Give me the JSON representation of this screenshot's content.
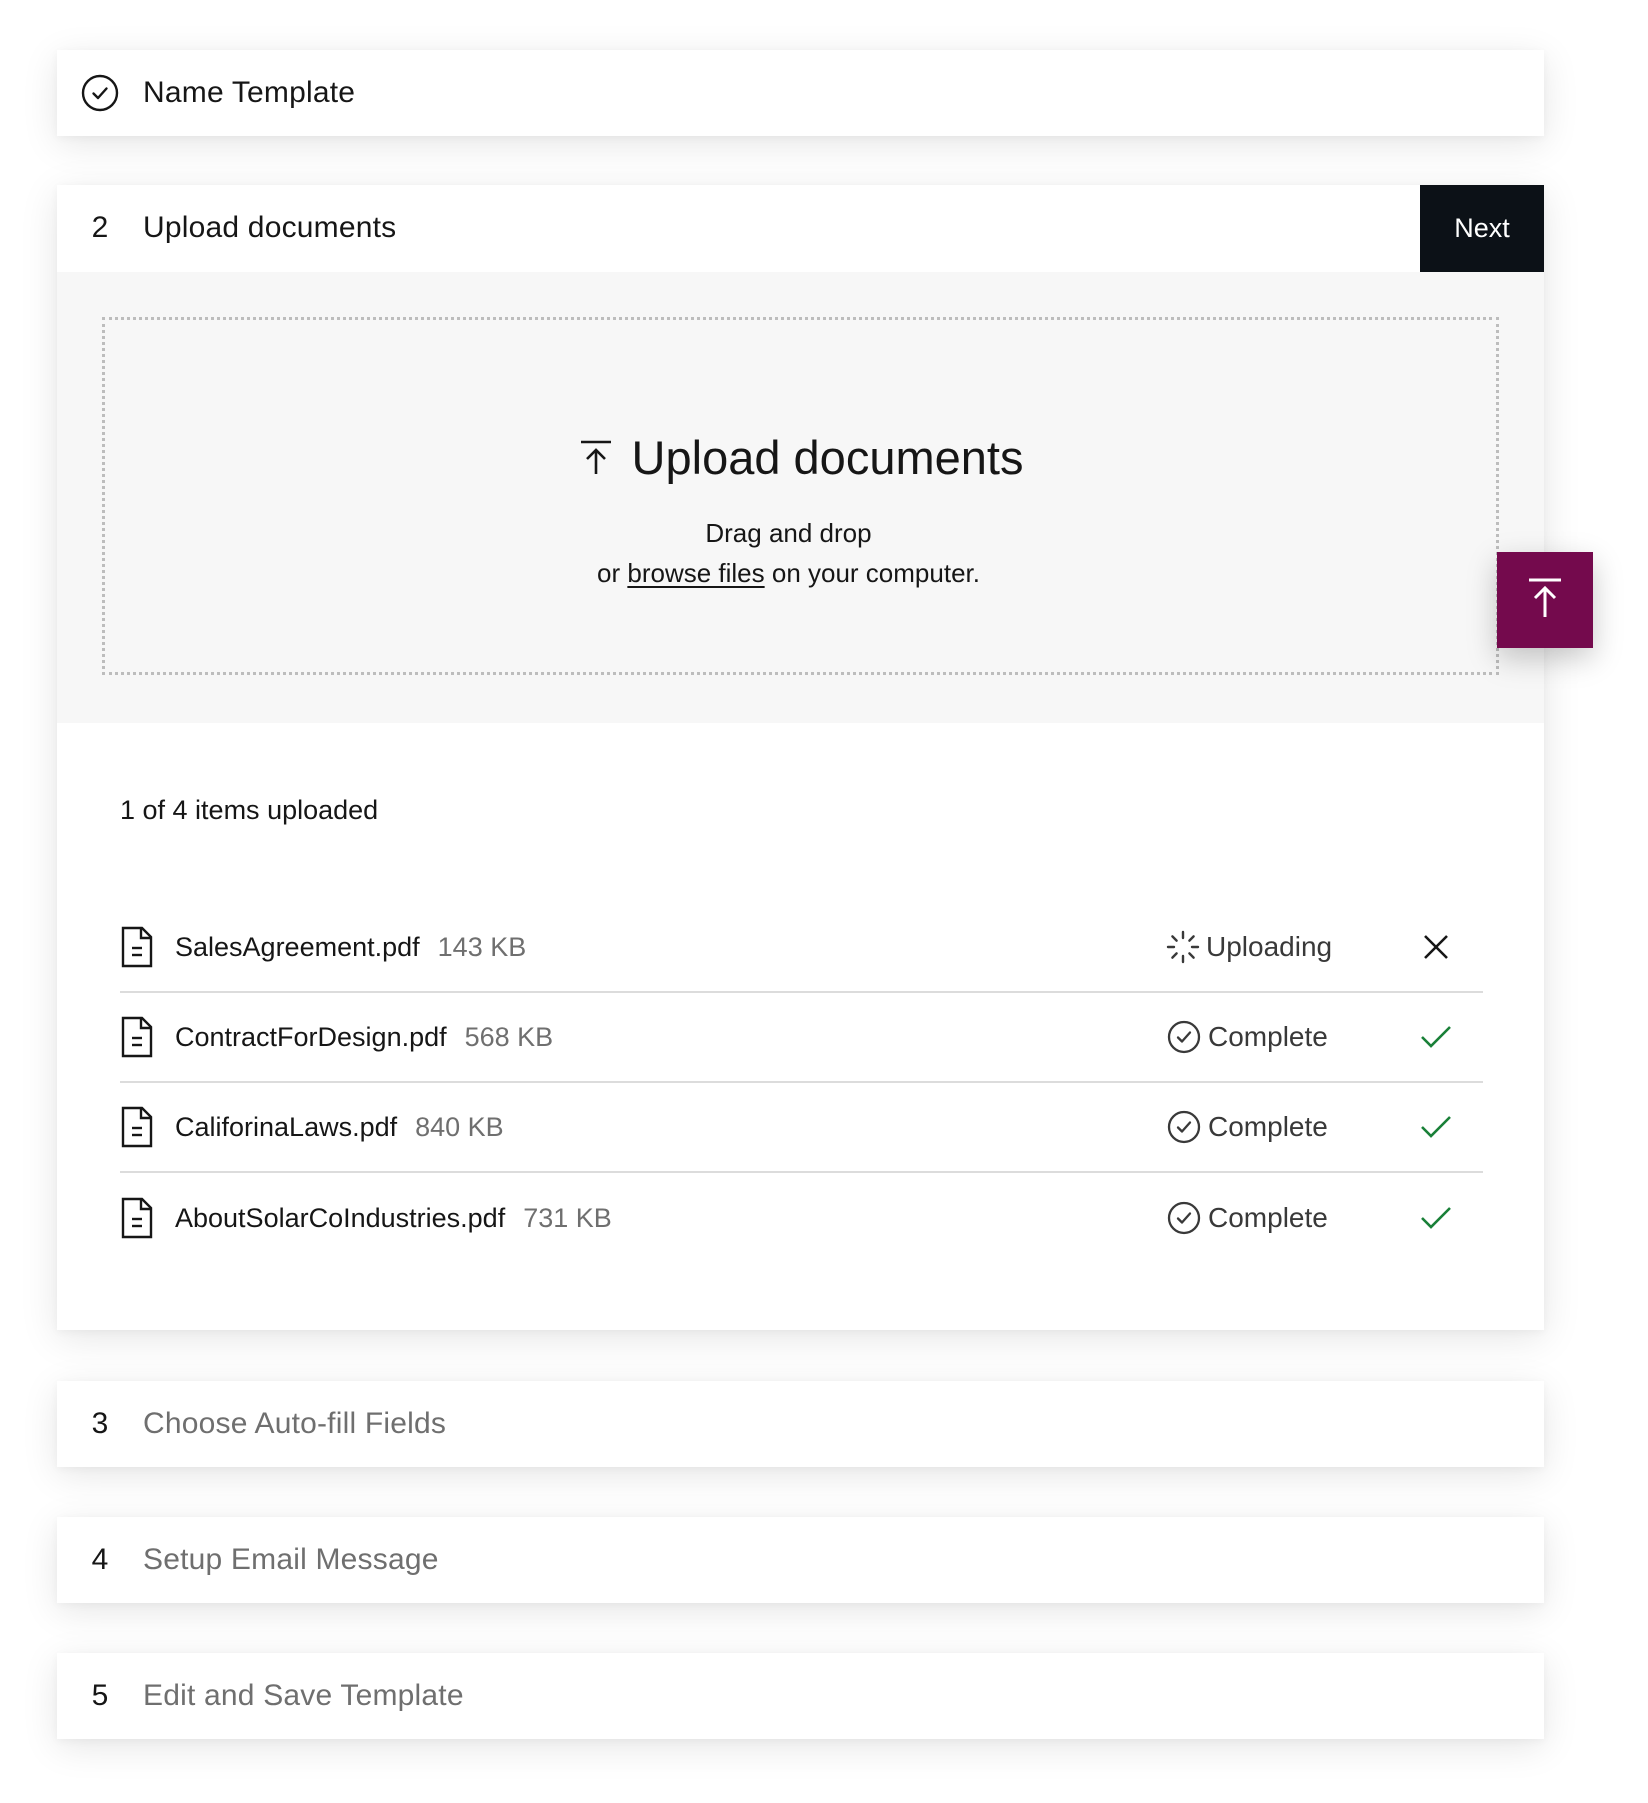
{
  "steps": [
    {
      "marker": "",
      "title": "Name Template",
      "state": "done"
    },
    {
      "marker": "2",
      "title": "Upload documents",
      "state": "active"
    },
    {
      "marker": "3",
      "title": "Choose Auto-fill Fields",
      "state": "pending"
    },
    {
      "marker": "4",
      "title": "Setup Email Message",
      "state": "pending"
    },
    {
      "marker": "5",
      "title": "Edit and Save Template",
      "state": "pending"
    }
  ],
  "next_label": "Next",
  "dropzone": {
    "heading": "Upload documents",
    "line1": "Drag and drop",
    "line2_prefix": "or ",
    "browse_link": "browse files",
    "line2_suffix": " on your computer."
  },
  "upload_summary": "1 of 4 items uploaded",
  "files": [
    {
      "name": "SalesAgreement.pdf",
      "size": "143 KB",
      "status": "Uploading",
      "status_icon": "spinner-icon",
      "action_icon": "close-icon"
    },
    {
      "name": "ContractForDesign.pdf",
      "size": "568 KB",
      "status": "Complete",
      "status_icon": "check-circle-icon",
      "action_icon": "checkmark-icon"
    },
    {
      "name": "CaliforinaLaws.pdf",
      "size": "840 KB",
      "status": "Complete",
      "status_icon": "check-circle-icon",
      "action_icon": "checkmark-icon"
    },
    {
      "name": "AboutSolarCoIndustries.pdf",
      "size": "731 KB",
      "status": "Complete",
      "status_icon": "check-circle-icon",
      "action_icon": "checkmark-icon"
    }
  ],
  "colors": {
    "accent": "#740a4d",
    "next_button": "#0c1117",
    "success": "#198038",
    "dropzone_bg": "#f7f7f7"
  }
}
